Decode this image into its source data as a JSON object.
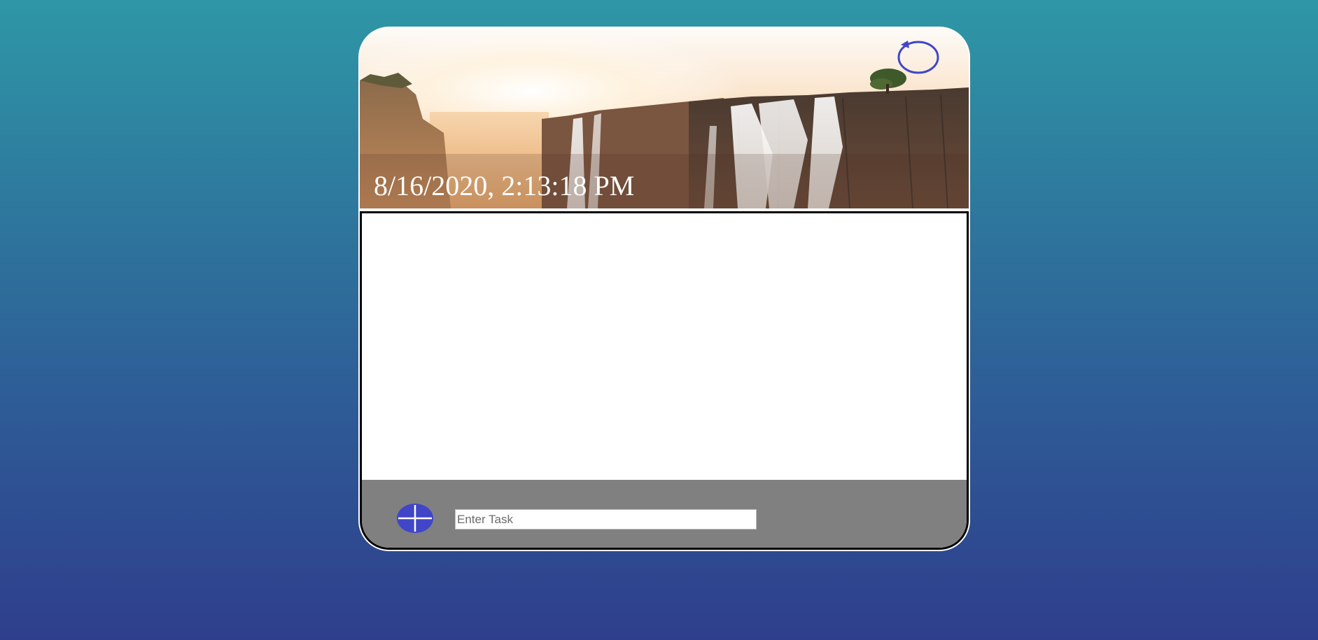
{
  "header": {
    "datetime": "8/16/2020, 2:13:18 PM",
    "background_image": "victoria-falls-sunset",
    "refresh_icon": "refresh-icon"
  },
  "task_list": {
    "items": []
  },
  "footer": {
    "add_icon": "plus-icon",
    "task_input": {
      "value": "",
      "placeholder": "Enter Task"
    }
  },
  "colors": {
    "page_gradient_top": "#2e97a6",
    "page_gradient_bottom": "#2f3e8c",
    "accent": "#4146c8",
    "footer_bg": "#808080"
  }
}
